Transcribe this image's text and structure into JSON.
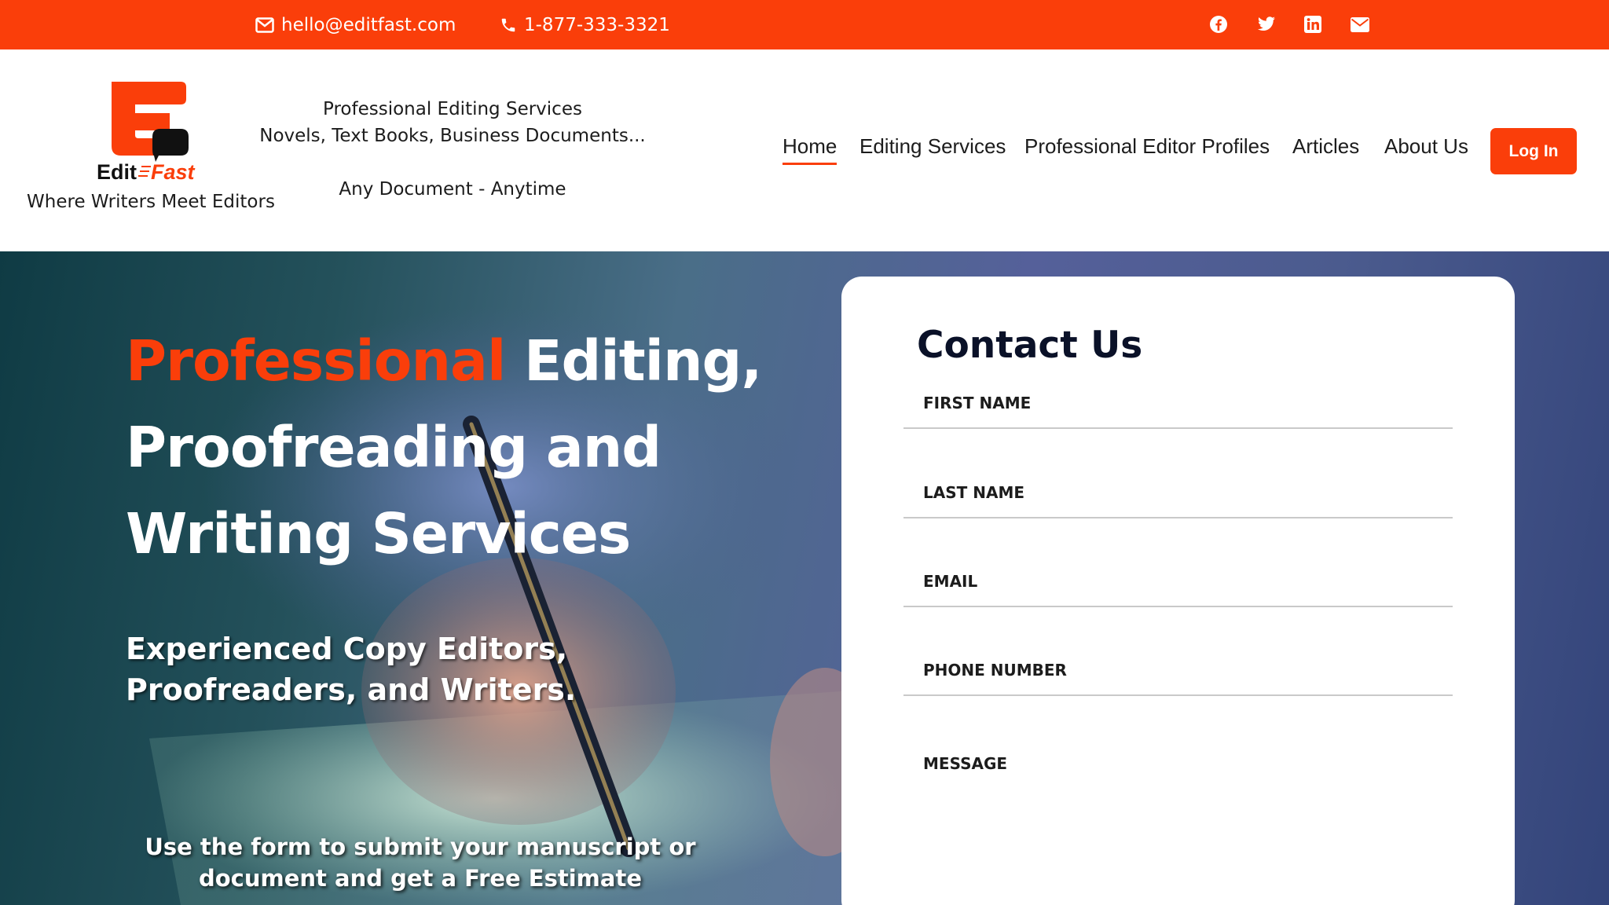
{
  "colors": {
    "brand": "#fa3e0a",
    "heading": "#0a1128",
    "text": "#1c1c1c"
  },
  "topbar": {
    "email": "hello@editfast.com",
    "phone": "1-877-333-3321",
    "socials": [
      "facebook-icon",
      "twitter-icon",
      "linkedin-icon",
      "envelope-icon"
    ]
  },
  "header": {
    "logo": {
      "letter": "E",
      "word1": "Edit",
      "word2": "Fast"
    },
    "tagline": "Where Writers Meet Editors",
    "promo": {
      "line1": "Professional Editing Services",
      "line2": "Novels, Text Books, Business Documents...",
      "line3": "Any Document - Anytime"
    },
    "nav": [
      {
        "label": "Home",
        "active": true
      },
      {
        "label": "Editing Services"
      },
      {
        "label": "Professional Editor Profiles"
      },
      {
        "label": "Articles"
      },
      {
        "label": "About Us"
      }
    ],
    "login_label": "Log In"
  },
  "hero": {
    "title_accent": "Professional",
    "title_rest_1": "Editing,",
    "title_line_2": "Proofreading and",
    "title_line_3": "Writing Services",
    "subtitle_1": "Experienced Copy Editors,",
    "subtitle_2": "Proofreaders, and Writers.",
    "note_1": "Use the form to submit your manuscript or",
    "note_2": "document and get a Free Estimate"
  },
  "contact": {
    "title": "Contact Us",
    "fields": {
      "first_name": "FIRST NAME",
      "last_name": "LAST NAME",
      "email": "EMAIL",
      "phone": "PHONE NUMBER",
      "message": "MESSAGE"
    }
  }
}
